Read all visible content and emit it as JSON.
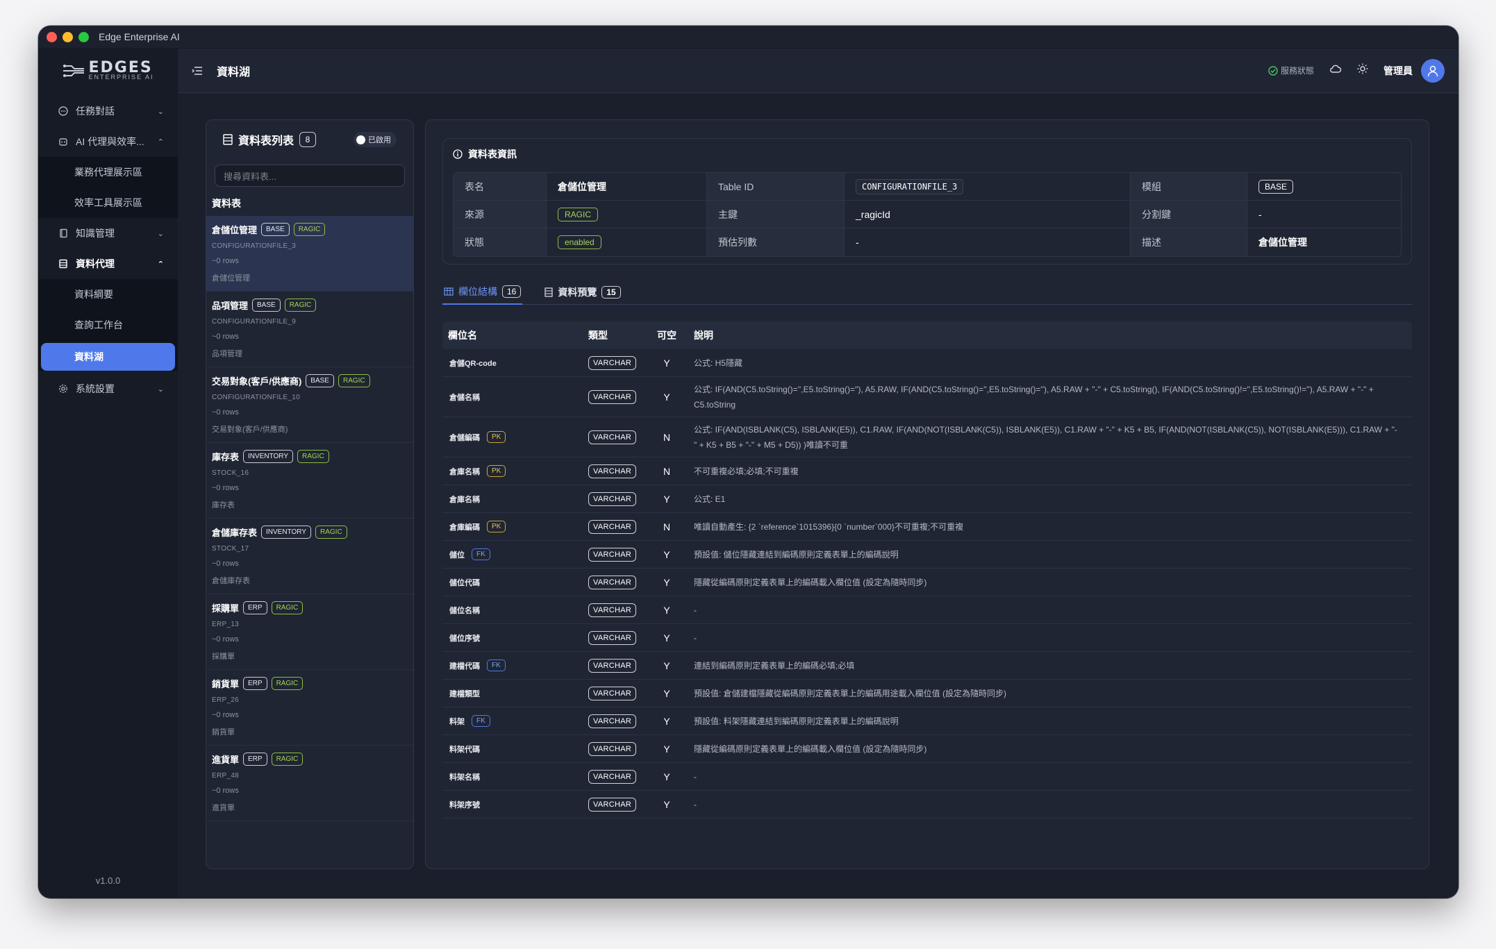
{
  "window": {
    "title": "Edge Enterprise AI"
  },
  "logo": {
    "main": "EDGES",
    "sub": "ENTERPRISE AI"
  },
  "sidebar": {
    "items": [
      {
        "label": "任務對話",
        "icon": "chat-icon"
      },
      {
        "label": "AI 代理與效率...",
        "icon": "robot-icon"
      },
      {
        "label": "知識管理",
        "icon": "book-icon"
      },
      {
        "label": "資料代理",
        "icon": "database-icon"
      },
      {
        "label": "系統設置",
        "icon": "gear-icon"
      }
    ],
    "ai_sub": [
      "業務代理展示區",
      "效率工具展示區"
    ],
    "data_sub": [
      "資料綱要",
      "查詢工作台",
      "資料湖"
    ],
    "version": "v1.0.0"
  },
  "topbar": {
    "title": "資料湖",
    "status": "服務狀態",
    "user": "管理員"
  },
  "list": {
    "title": "資料表列表",
    "count": "8",
    "toggle": "已啟用",
    "search_placeholder": "搜尋資料表...",
    "section": "資料表",
    "tables": [
      {
        "name": "倉儲位管理",
        "tags": [
          "BASE",
          "RAGIC"
        ],
        "id": "CONFIGURATIONFILE_3",
        "rows": "~0 rows",
        "desc": "倉儲位管理"
      },
      {
        "name": "品項管理",
        "tags": [
          "BASE",
          "RAGIC"
        ],
        "id": "CONFIGURATIONFILE_9",
        "rows": "~0 rows",
        "desc": "品項管理"
      },
      {
        "name": "交易對象(客戶/供應商)",
        "tags": [
          "BASE",
          "RAGIC"
        ],
        "id": "CONFIGURATIONFILE_10",
        "rows": "~0 rows",
        "desc": "交易對象(客戶/供應商)"
      },
      {
        "name": "庫存表",
        "tags": [
          "INVENTORY",
          "RAGIC"
        ],
        "id": "STOCK_16",
        "rows": "~0 rows",
        "desc": "庫存表"
      },
      {
        "name": "倉儲庫存表",
        "tags": [
          "INVENTORY",
          "RAGIC"
        ],
        "id": "STOCK_17",
        "rows": "~0 rows",
        "desc": "倉儲庫存表"
      },
      {
        "name": "採購單",
        "tags": [
          "ERP",
          "RAGIC"
        ],
        "id": "ERP_13",
        "rows": "~0 rows",
        "desc": "採購單"
      },
      {
        "name": "銷貨單",
        "tags": [
          "ERP",
          "RAGIC"
        ],
        "id": "ERP_26",
        "rows": "~0 rows",
        "desc": "銷貨單"
      },
      {
        "name": "進貨單",
        "tags": [
          "ERP",
          "RAGIC"
        ],
        "id": "ERP_48",
        "rows": "~0 rows",
        "desc": "進貨單"
      }
    ]
  },
  "info": {
    "title": "資料表資訊",
    "k_name": "表名",
    "v_name": "倉儲位管理",
    "k_tid": "Table ID",
    "v_tid": "CONFIGURATIONFILE_3",
    "k_module": "模組",
    "v_module": "BASE",
    "k_source": "來源",
    "v_source": "RAGIC",
    "k_pk": "主鍵",
    "v_pk": "_ragicId",
    "k_split": "分割鍵",
    "v_split": "-",
    "k_status": "狀態",
    "v_status": "enabled",
    "k_rows": "預估列數",
    "v_rows": "-",
    "k_desc": "描述",
    "v_desc": "倉儲位管理"
  },
  "tabs": [
    {
      "label": "欄位結構",
      "count": "16"
    },
    {
      "label": "資料預覽",
      "count": "15"
    }
  ],
  "grid": {
    "headers": [
      "欄位名",
      "類型",
      "可空",
      "說明"
    ],
    "rows": [
      {
        "name": "倉儲QR-code",
        "key": "",
        "type": "VARCHAR",
        "null": "Y",
        "desc": "公式: H5隱藏"
      },
      {
        "name": "倉儲名稱",
        "key": "",
        "type": "VARCHAR",
        "null": "Y",
        "desc": "公式: IF(AND(C5.toString()='',E5.toString()=''), A5.RAW, IF(AND(C5.toString()='',E5.toString()=''), A5.RAW + \"-\" + C5.toString(), IF(AND(C5.toString()!='',E5.toString()!=''), A5.RAW + \"-\" + C5.toString"
      },
      {
        "name": "倉儲編碼",
        "key": "PK",
        "type": "VARCHAR",
        "null": "N",
        "desc": "公式: IF(AND(ISBLANK(C5), ISBLANK(E5)), C1.RAW, IF(AND(NOT(ISBLANK(C5)), ISBLANK(E5)), C1.RAW + \"-\" + K5 + B5, IF(AND(NOT(ISBLANK(C5)), NOT(ISBLANK(E5))), C1.RAW + \"-\" + K5 + B5 + \"-\" + M5 + D5)) )唯讀不可重"
      },
      {
        "name": "倉庫名稱",
        "key": "PK",
        "type": "VARCHAR",
        "null": "N",
        "desc": "不可重複必填;必填;不可重複"
      },
      {
        "name": "倉庫名稱",
        "key": "",
        "type": "VARCHAR",
        "null": "Y",
        "desc": "公式: E1"
      },
      {
        "name": "倉庫編碼",
        "key": "PK",
        "type": "VARCHAR",
        "null": "N",
        "desc": "唯讀自動產生: {2 `reference`1015396}{0 `number`000}不可重複;不可重複"
      },
      {
        "name": "儲位",
        "key": "FK",
        "type": "VARCHAR",
        "null": "Y",
        "desc": "預設值: 儲位隱藏連結到編碼原則定義表單上的編碼說明"
      },
      {
        "name": "儲位代碼",
        "key": "",
        "type": "VARCHAR",
        "null": "Y",
        "desc": "隱藏從編碼原則定義表單上的編碼載入欄位值 (設定為隨時同步)"
      },
      {
        "name": "儲位名稱",
        "key": "",
        "type": "VARCHAR",
        "null": "Y",
        "desc": "-"
      },
      {
        "name": "儲位序號",
        "key": "",
        "type": "VARCHAR",
        "null": "Y",
        "desc": "-"
      },
      {
        "name": "建檔代碼",
        "key": "FK",
        "type": "VARCHAR",
        "null": "Y",
        "desc": "連結到編碼原則定義表單上的編碼必填;必填"
      },
      {
        "name": "建檔類型",
        "key": "",
        "type": "VARCHAR",
        "null": "Y",
        "desc": "預設值: 倉儲建檔隱藏從編碼原則定義表單上的編碼用途載入欄位值 (設定為隨時同步)"
      },
      {
        "name": "料架",
        "key": "FK",
        "type": "VARCHAR",
        "null": "Y",
        "desc": "預設值: 料架隱藏連結到編碼原則定義表單上的編碼說明"
      },
      {
        "name": "料架代碼",
        "key": "",
        "type": "VARCHAR",
        "null": "Y",
        "desc": "隱藏從編碼原則定義表單上的編碼載入欄位值 (設定為隨時同步)"
      },
      {
        "name": "料架名稱",
        "key": "",
        "type": "VARCHAR",
        "null": "Y",
        "desc": "-"
      },
      {
        "name": "料架序號",
        "key": "",
        "type": "VARCHAR",
        "null": "Y",
        "desc": "-"
      }
    ]
  }
}
